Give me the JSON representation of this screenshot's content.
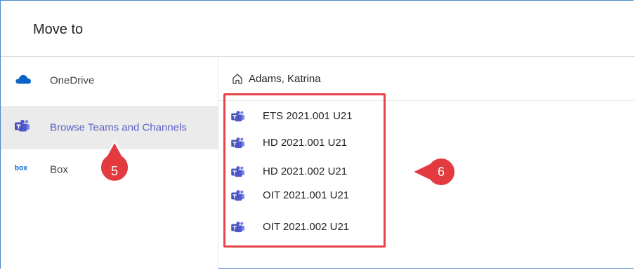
{
  "dialog": {
    "title": "Move to"
  },
  "sidebar": {
    "items": [
      {
        "label": "OneDrive",
        "icon": "onedrive-cloud-icon",
        "active": false
      },
      {
        "label": "Browse Teams and Channels",
        "icon": "teams-icon",
        "active": true
      },
      {
        "label": "Box",
        "icon": "box-logo-icon",
        "active": false
      }
    ]
  },
  "breadcrumb": {
    "icon": "home-icon",
    "label": "Adams, Katrina"
  },
  "teams": [
    {
      "label": "ETS 2021.001 U21"
    },
    {
      "label": "HD 2021.001 U21"
    },
    {
      "label": "HD 2021.002 U21"
    },
    {
      "label": "OIT 2021.001 U21"
    },
    {
      "label": "OIT 2021.002 U21"
    }
  ],
  "annotations": {
    "callout_5": "5",
    "callout_6": "6"
  },
  "colors": {
    "accent": "#5b5fc7",
    "teams_icon": "#5059c9",
    "highlight": "#e8434a",
    "callout": "#e23a3f",
    "onedrive": "#0a64c8",
    "frame": "#4a86c8"
  }
}
